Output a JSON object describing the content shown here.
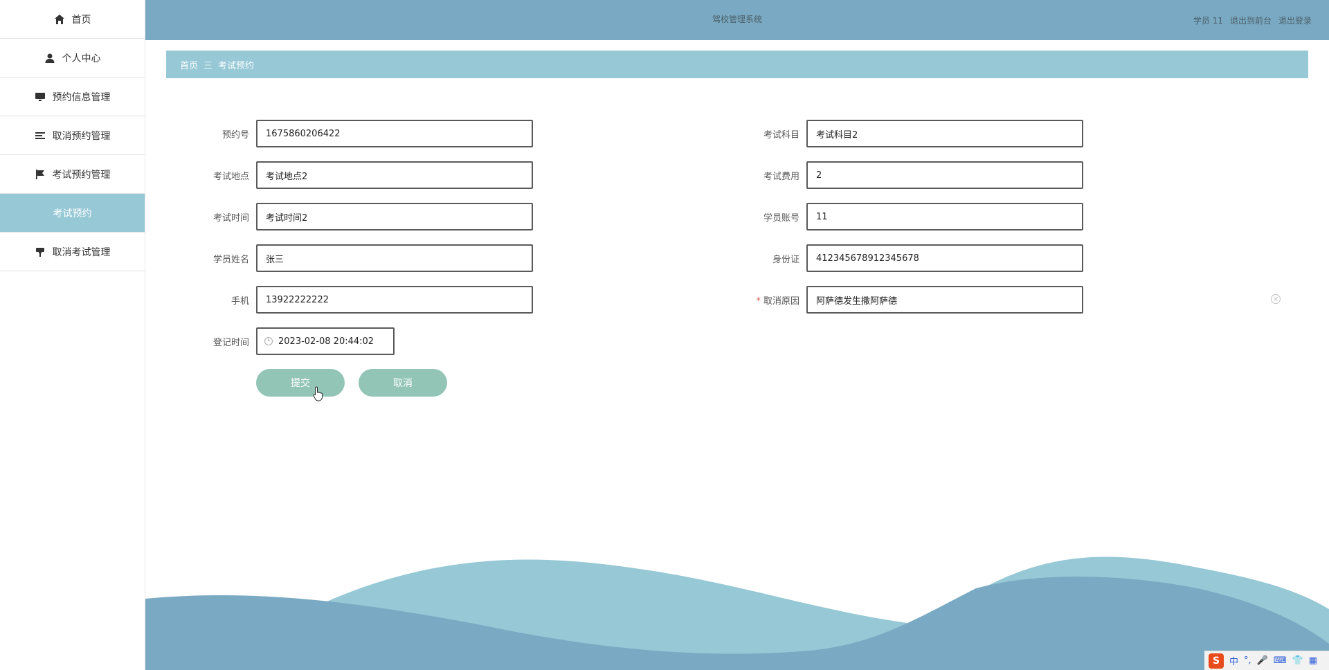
{
  "sidebar": {
    "items": [
      {
        "label": "首页",
        "icon": "home-icon"
      },
      {
        "label": "个人中心",
        "icon": "user-icon"
      },
      {
        "label": "预约信息管理",
        "icon": "monitor-icon"
      },
      {
        "label": "取消预约管理",
        "icon": "list-icon"
      },
      {
        "label": "考试预约管理",
        "icon": "flag-icon"
      },
      {
        "label": "考试预约",
        "icon": ""
      },
      {
        "label": "取消考试管理",
        "icon": "pin-icon"
      }
    ]
  },
  "topbar": {
    "title": "驾校管理系统",
    "user": "学员 11",
    "back_to_front": "退出到前台",
    "logout": "退出登录"
  },
  "breadcrumb": {
    "home": "首页",
    "separator": "三",
    "current": "考试预约"
  },
  "form": {
    "booking_no": {
      "label": "预约号",
      "value": "1675860206422"
    },
    "subject": {
      "label": "考试科目",
      "value": "考试科目2"
    },
    "location": {
      "label": "考试地点",
      "value": "考试地点2"
    },
    "fee": {
      "label": "考试费用",
      "value": "2"
    },
    "time": {
      "label": "考试时间",
      "value": "考试时间2"
    },
    "account": {
      "label": "学员账号",
      "value": "11"
    },
    "name": {
      "label": "学员姓名",
      "value": "张三"
    },
    "id_card": {
      "label": "身份证",
      "value": "412345678912345678"
    },
    "phone": {
      "label": "手机",
      "value": "13922222222"
    },
    "reason": {
      "label": "取消原因",
      "required_mark": "*",
      "value": "阿萨德发生撒阿萨德"
    },
    "register_time": {
      "label": "登记时间",
      "value": "2023-02-08 20:44:02"
    }
  },
  "buttons": {
    "submit": "提交",
    "cancel": "取消"
  },
  "ime": {
    "logo": "S",
    "mode": "中",
    "punct": "°,"
  },
  "colors": {
    "topbar": "#7aaac3",
    "accent": "#96c8d6",
    "button": "#93c5b7"
  }
}
